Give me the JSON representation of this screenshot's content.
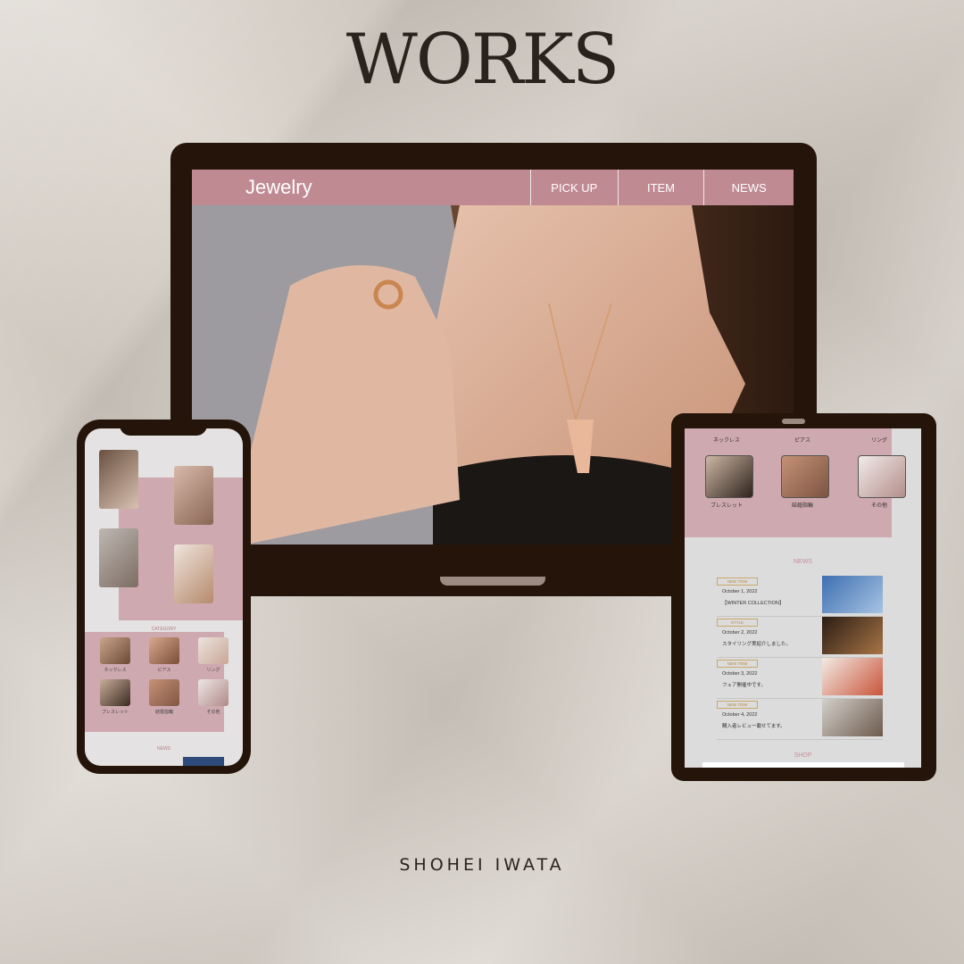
{
  "title": "WORKS",
  "author": "SHOHEI IWATA",
  "laptop": {
    "logo": "Jewelry",
    "nav": [
      "PICK UP",
      "ITEM",
      "NEWS"
    ]
  },
  "phone": {
    "category_title": "CATEGORY",
    "categories": [
      "ネックレス",
      "ピアス",
      "リング",
      "ブレスレット",
      "結婚指輪",
      "その他"
    ],
    "news_title": "NEWS"
  },
  "tablet": {
    "categories_top": [
      "ネックレス",
      "ピアス",
      "リング"
    ],
    "categories": [
      "ブレスレット",
      "結婚指輪",
      "その他"
    ],
    "news_title": "NEWS",
    "news": [
      {
        "badge": "NEW ITEM",
        "date": "October 1, 2022",
        "text": "【WINTER COLLECTION】"
      },
      {
        "badge": "STYLE",
        "date": "October 2, 2022",
        "text": "スタイリング実紹介しました。"
      },
      {
        "badge": "NEW ITEM",
        "date": "October 3, 2022",
        "text": "フェア開催中です。"
      },
      {
        "badge": "NEW ITEM",
        "date": "October 4, 2022",
        "text": "購入者レビュー載せてます。"
      }
    ],
    "shop_title": "SHOP"
  },
  "colors": {
    "accent_pink": "#c08a92",
    "device_frame": "#241409",
    "text_dark": "#2a231d"
  }
}
